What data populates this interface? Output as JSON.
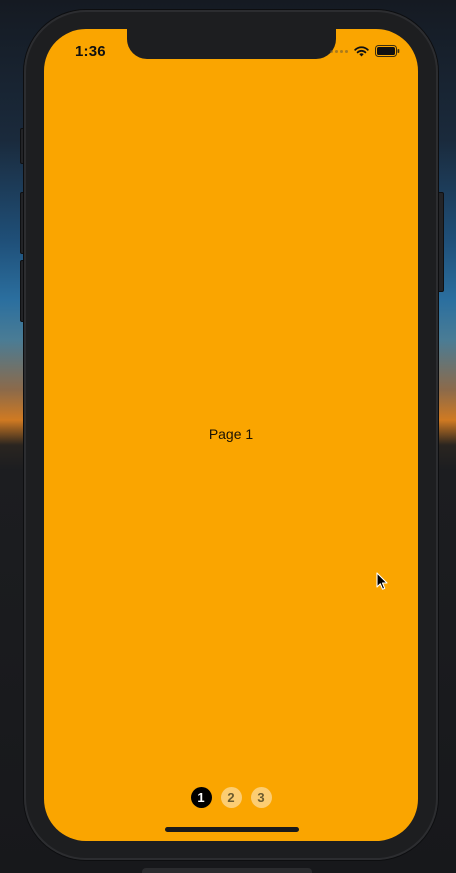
{
  "status_bar": {
    "time": "1:36"
  },
  "page": {
    "label": "Page 1"
  },
  "page_indicator": {
    "pages": [
      "1",
      "2",
      "3"
    ],
    "active_index": 0
  },
  "colors": {
    "screen_background": "#faa500",
    "active_dot": "#000000",
    "inactive_dot": "rgba(255,255,255,0.45)"
  },
  "icons": [
    "cellular-signal-icon",
    "wifi-icon",
    "battery-icon",
    "pointer-cursor-icon"
  ]
}
